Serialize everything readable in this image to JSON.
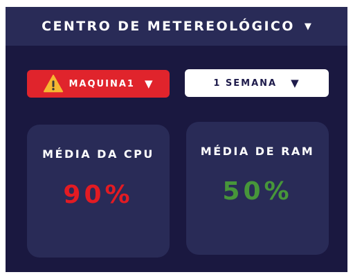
{
  "header": {
    "title": "CENTRO DE METEREOLÓGICO",
    "caret_icon": "triangle-down-icon"
  },
  "filters": {
    "machine": {
      "label": "MAQUINA1",
      "icon": "warning-icon",
      "caret_icon": "triangle-down-icon",
      "color": "#e0242c"
    },
    "period": {
      "label": "1 SEMANA",
      "caret_icon": "triangle-down-icon",
      "color": "#ffffff"
    }
  },
  "metrics": {
    "cpu": {
      "label": "MÉDIA DA CPU",
      "value": "90%",
      "color": "#e21b23"
    },
    "ram": {
      "label": "MÉDIA DE RAM",
      "value": "50%",
      "color": "#47963a"
    }
  },
  "theme": {
    "background": "#1a1840",
    "panel": "#292b57"
  }
}
